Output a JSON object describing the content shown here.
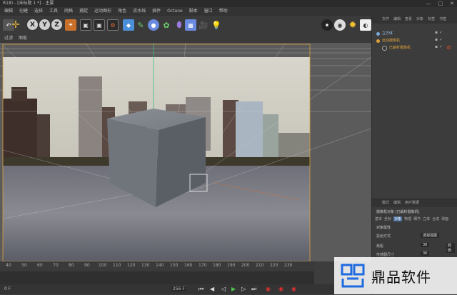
{
  "window": {
    "title": "R18) - [未标题 1 *] - 主要",
    "controls": [
      "—",
      "□",
      "✕"
    ]
  },
  "menubar": [
    "编辑",
    "创建",
    "选择",
    "工具",
    "网格",
    "捕捉",
    "运动图形",
    "角色",
    "流水线",
    "插件",
    "Octane",
    "脚本",
    "窗口",
    "帮助"
  ],
  "viewport": {
    "menu": [
      "过滤",
      "面板"
    ]
  },
  "object_manager": {
    "tabs": [
      "文件",
      "编辑",
      "查看",
      "对象",
      "标签",
      "书签"
    ],
    "objects": [
      {
        "name": "立方体",
        "color": "#7aa7d8"
      },
      {
        "name": "运动摄像机",
        "color": "#e0a23a"
      },
      {
        "name": "已解析摄像机",
        "color": "#e0a23a"
      }
    ]
  },
  "attributes": {
    "tabs": [
      "模式",
      "编辑",
      "用户数据"
    ],
    "header": "摄像机对象 [已解析摄像机]",
    "subtabs": [
      "基本",
      "坐标",
      "对象",
      "物理",
      "细节",
      "立体",
      "合成",
      "球面"
    ],
    "section": "对象属性",
    "rows": [
      {
        "label": "投射方式",
        "value": "透视视图"
      },
      {
        "label": "焦距",
        "value": "36",
        "extra": "经典"
      },
      {
        "label": "传感器尺寸",
        "value": "36"
      }
    ]
  },
  "timeline": {
    "ticks": [
      "40",
      "50",
      "60",
      "70",
      "80",
      "90",
      "100",
      "110",
      "120",
      "130",
      "140",
      "150",
      "160",
      "170",
      "180",
      "190",
      "200",
      "210",
      "220",
      "230"
    ],
    "frame_start": "0 F",
    "frame_end": "256 F"
  },
  "watermark": {
    "text": "鼎品软件"
  },
  "colors": {
    "accent_yellow": "#e0b03a",
    "selected_orange": "#f0a030"
  }
}
